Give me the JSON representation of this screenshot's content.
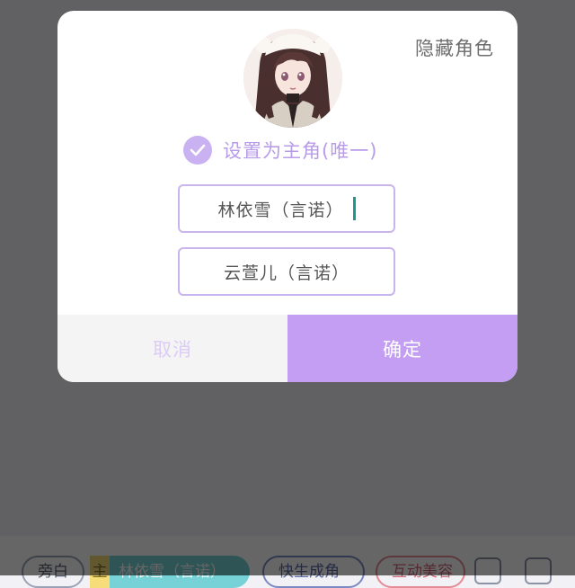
{
  "background": {
    "chips": {
      "bystander": "旁白",
      "main_tag": "主",
      "role_lin": "林依雪（言诺）",
      "generate_role": "快生成角",
      "interactive_beauty": "互动美容"
    },
    "icons": [
      "grid-icon",
      "more-icon"
    ]
  },
  "dialog": {
    "hide_role_label": "隐藏角色",
    "set_main_label": "设置为主角(唯一)",
    "set_main_checked": true,
    "roles": [
      {
        "name": "林依雪（言诺）",
        "active": true
      },
      {
        "name": "云萱儿（言诺）",
        "active": false
      }
    ],
    "cancel_label": "取消",
    "confirm_label": "确定"
  },
  "colors": {
    "accent": "#c49ef2",
    "check": "#c9b1f2",
    "cursor": "#1a9b8e"
  }
}
